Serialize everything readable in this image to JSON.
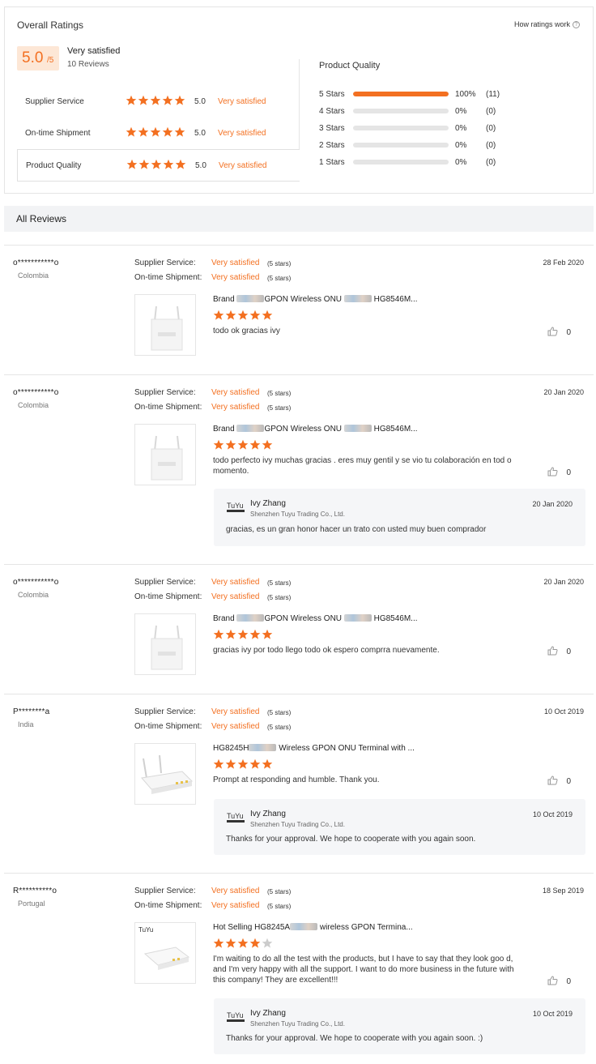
{
  "overall": {
    "title": "Overall Ratings",
    "how_link": "How ratings work",
    "score": "5.0",
    "score_suffix": "/5",
    "label": "Very satisfied",
    "count": "10 Reviews",
    "categories": [
      {
        "name": "Supplier Service",
        "score": "5.0",
        "text": "Very satisfied",
        "stars": 5
      },
      {
        "name": "On-time Shipment",
        "score": "5.0",
        "text": "Very satisfied",
        "stars": 5
      },
      {
        "name": "Product Quality",
        "score": "5.0",
        "text": "Very satisfied",
        "stars": 5
      }
    ],
    "distribution_title": "Product Quality",
    "distribution": [
      {
        "label": "5  Stars",
        "pct": "100%",
        "count": "(11)",
        "fraction": 1.0
      },
      {
        "label": "4  Stars",
        "pct": "0%",
        "count": "(0)",
        "fraction": 0
      },
      {
        "label": "3  Stars",
        "pct": "0%",
        "count": "(0)",
        "fraction": 0
      },
      {
        "label": "2  Stars",
        "pct": "0%",
        "count": "(0)",
        "fraction": 0
      },
      {
        "label": "1  Stars",
        "pct": "0%",
        "count": "(0)",
        "fraction": 0
      }
    ]
  },
  "all_reviews": {
    "title": "All Reviews"
  },
  "colors": {
    "accent": "#f37021",
    "star_empty": "#cccccc"
  },
  "reviews": [
    {
      "user": "o***********o",
      "country": "Colombia",
      "date": "28 Feb 2020",
      "supplier_label": "Supplier Service:",
      "supplier_value": "Very satisfied",
      "supplier_stars": "(5 stars)",
      "shipment_label": "On-time Shipment:",
      "shipment_value": "Very satisfied",
      "shipment_stars": "(5 stars)",
      "product_pre": "Brand ",
      "product_mid": "GPON Wireless ONU",
      "product_post": "HG8546M...",
      "rating": 5,
      "text": "todo ok gracias ivy",
      "likes": "0",
      "reply": null
    },
    {
      "user": "o***********o",
      "country": "Colombia",
      "date": "20 Jan 2020",
      "supplier_label": "Supplier Service:",
      "supplier_value": "Very satisfied",
      "supplier_stars": "(5 stars)",
      "shipment_label": "On-time Shipment:",
      "shipment_value": "Very satisfied",
      "shipment_stars": "(5 stars)",
      "product_pre": "Brand ",
      "product_mid": "GPON Wireless ONU",
      "product_post": "HG8546M...",
      "rating": 5,
      "text": "todo perfecto ivy muchas gracias . eres muy gentil y se vio tu colaboración en tod o momento.",
      "likes": "0",
      "reply": {
        "name": "Ivy Zhang",
        "company": "Shenzhen Tuyu Trading Co., Ltd.",
        "date": "20 Jan 2020",
        "text": "gracias, es un gran honor hacer un trato con usted muy buen comprador",
        "logo": "TuYu"
      }
    },
    {
      "user": "o***********o",
      "country": "Colombia",
      "date": "20 Jan 2020",
      "supplier_label": "Supplier Service:",
      "supplier_value": "Very satisfied",
      "supplier_stars": "(5 stars)",
      "shipment_label": "On-time Shipment:",
      "shipment_value": "Very satisfied",
      "shipment_stars": "(5 stars)",
      "product_pre": "Brand ",
      "product_mid": "GPON Wireless ONU",
      "product_post": "HG8546M...",
      "rating": 5,
      "text": "gracias ivy por todo llego todo ok espero comprra nuevamente.",
      "likes": "0",
      "reply": null
    },
    {
      "user": "P********a",
      "country": "India",
      "date": "10 Oct 2019",
      "supplier_label": "Supplier Service:",
      "supplier_value": "Very satisfied",
      "supplier_stars": "(5 stars)",
      "shipment_label": "On-time Shipment:",
      "shipment_value": "Very satisfied",
      "shipment_stars": "(5 stars)",
      "product_pre": "HG8245H",
      "product_mid": "Wireless GPON ONU Terminal with ...",
      "product_post": "",
      "rating": 5,
      "text": "Prompt at responding and humble. Thank you.",
      "likes": "0",
      "reply": {
        "name": "Ivy Zhang",
        "company": "Shenzhen Tuyu Trading Co., Ltd.",
        "date": "10 Oct 2019",
        "text": "Thanks for your approval. We hope to cooperate with you again soon.",
        "logo": "TuYu"
      }
    },
    {
      "user": "R**********o",
      "country": "Portugal",
      "date": "18 Sep 2019",
      "supplier_label": "Supplier Service:",
      "supplier_value": "Very satisfied",
      "supplier_stars": "(5 stars)",
      "shipment_label": "On-time Shipment:",
      "shipment_value": "Very satisfied",
      "shipment_stars": "(5 stars)",
      "product_pre": "Hot Selling HG8245A",
      "product_mid": "wireless GPON Termina...",
      "product_post": "",
      "rating": 4,
      "text": "I'm waiting to do all the test with the products, but I have to say that they look goo d, and I'm very happy with all the support. I want to do more business in the future with this company! They are excellent!!!",
      "likes": "0",
      "reply": {
        "name": "Ivy Zhang",
        "company": "Shenzhen Tuyu Trading Co., Ltd.",
        "date": "10 Oct 2019",
        "text": "Thanks for your approval. We hope to cooperate with you again soon. :)",
        "logo": "TuYu"
      }
    }
  ]
}
